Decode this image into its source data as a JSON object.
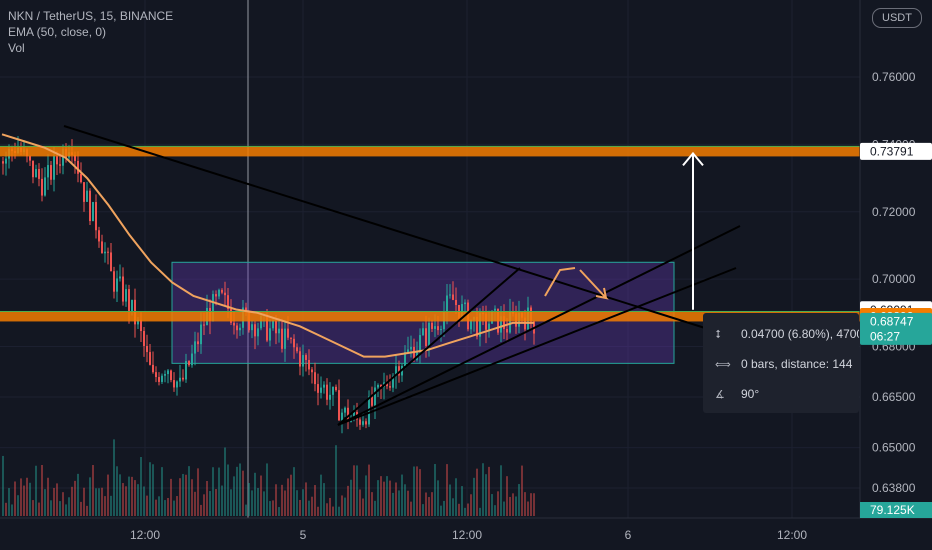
{
  "legend": {
    "symbol": "NKN / TetherUS, 15, BINANCE",
    "indicator": "EMA (50, close, 0)",
    "volume": "Vol"
  },
  "currency_button": "USDT",
  "price_tags": [
    {
      "text": "0.73791",
      "value": 0.73791,
      "bg": "#ffffff",
      "fg": "#131722"
    },
    {
      "text": "0.69091",
      "value": 0.69091,
      "bg": "#ffffff",
      "fg": "#131722"
    },
    {
      "text": "0.68892",
      "value": 0.68892,
      "bg": "#f57c00",
      "fg": "#ffffff"
    },
    {
      "text": "0.68747",
      "sub": "06:27",
      "value": 0.68747,
      "bg": "#26a69a",
      "fg": "#ffffff"
    }
  ],
  "volume_tag": "79.125K",
  "tooltip": {
    "line1": "0.04700 (6.80%), 4700",
    "line2": "0 bars, distance: 144",
    "line3": "90°"
  },
  "colors": {
    "background": "#131722",
    "up": "#26a69a",
    "down": "#ef5350",
    "ema": "#f0a35e",
    "range_box": "#673ab7",
    "resistance_line": "#f57c00",
    "text": "#b2b5be"
  },
  "chart_data": {
    "type": "candlestick",
    "title": "NKN / TetherUS, 15, BINANCE",
    "x_ticks": [
      "12:00",
      "5",
      "12:00",
      "6",
      "12:00"
    ],
    "y_ticks": [
      0.76,
      0.74,
      0.72,
      0.7,
      0.68,
      0.665,
      0.65,
      0.638
    ],
    "y_tick_labels": [
      "0.76000",
      "0.74000",
      "0.72000",
      "0.70000",
      "0.68000",
      "0.66500",
      "0.65000",
      "0.63800"
    ],
    "ylim": [
      0.631,
      0.775
    ],
    "price_series_approx": [
      0.735,
      0.74,
      0.733,
      0.728,
      0.735,
      0.742,
      0.725,
      0.715,
      0.7,
      0.695,
      0.685,
      0.67,
      0.675,
      0.668,
      0.678,
      0.69,
      0.694,
      0.689,
      0.688,
      0.686,
      0.684,
      0.681,
      0.676,
      0.67,
      0.666,
      0.66,
      0.658,
      0.662,
      0.668,
      0.675,
      0.679,
      0.683,
      0.688,
      0.694,
      0.689,
      0.686,
      0.688,
      0.686,
      0.69,
      0.687
    ],
    "ema_approx": [
      0.743,
      0.741,
      0.739,
      0.736,
      0.73,
      0.722,
      0.713,
      0.705,
      0.699,
      0.695,
      0.693,
      0.691,
      0.69,
      0.688,
      0.686,
      0.683,
      0.68,
      0.677,
      0.677,
      0.678,
      0.679,
      0.681,
      0.683,
      0.685,
      0.687,
      0.687
    ],
    "horizontal_levels": [
      0.73791,
      0.68892
    ],
    "range_box": {
      "top": 0.705,
      "bottom": 0.675
    },
    "measure": {
      "from": 0.69091,
      "to": 0.73791,
      "change": 0.047,
      "percent": 6.8
    }
  }
}
